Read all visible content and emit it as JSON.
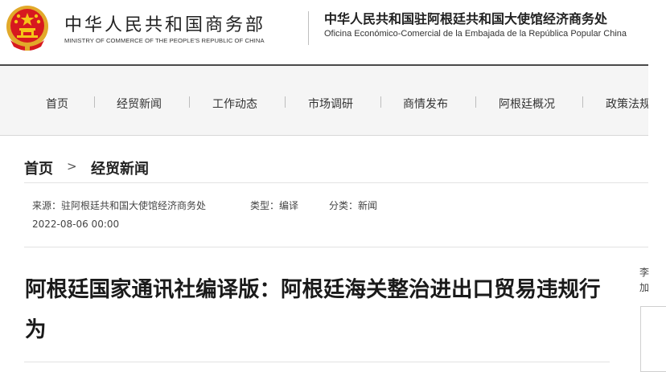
{
  "header": {
    "ministry_cn": "中华人民共和国商务部",
    "ministry_en": "MINISTRY OF COMMERCE OF THE PEOPLE'S REPUBLIC OF CHINA",
    "office_cn": "中华人民共和国驻阿根廷共和国大使馆经济商务处",
    "office_es": "Oficina Económico-Comercial de la Embajada de la República Popular China"
  },
  "nav": {
    "items": [
      "首页",
      "经贸新闻",
      "工作动态",
      "市场调研",
      "商情发布",
      "阿根廷概况",
      "政策法规"
    ]
  },
  "breadcrumb": {
    "home": "首页",
    "current": "经贸新闻"
  },
  "article": {
    "source": "来源：驻阿根廷共和国大使馆经济商务处",
    "type": "类型：编译",
    "category": "分类：新闻",
    "date": "2022-08-06 00:00",
    "title": "阿根廷国家通讯社编译版：阿根廷海关整治进出口贸易违规行为"
  },
  "sidebar": {
    "peek_1": "李",
    "peek_2": "加"
  },
  "colors": {
    "emblem_red": "#d7191f",
    "emblem_gold": "#f5c518",
    "header_line": "#4a4a4a",
    "nav_bg": "#f5f5f5"
  }
}
